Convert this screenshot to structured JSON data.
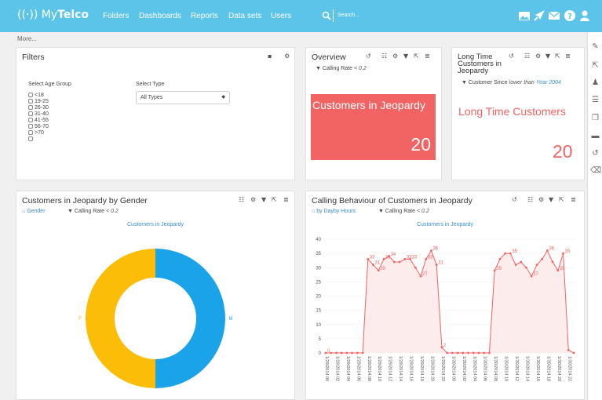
{
  "app": {
    "logo_icon": "((·))",
    "name_a": "My",
    "name_b": "Telco"
  },
  "nav": [
    "Folders",
    "Dashboards",
    "Reports",
    "Data sets",
    "Users"
  ],
  "search": {
    "placeholder": "Search..."
  },
  "toolbar_more": "More...",
  "filters": {
    "title": "Filters",
    "age_label": "Select Age Group",
    "age_options": [
      "<18",
      "19-25",
      "26-30",
      "31-40",
      "41-55",
      "56-70",
      ">70",
      ""
    ],
    "type_label": "Select Type",
    "type_value": "All Types"
  },
  "overview": {
    "title": "Overview",
    "filter_label": "Calling Rate",
    "filter_value": "< 0.2",
    "kpi_label": "Customers in Jeopardy",
    "kpi_value": "20"
  },
  "longtime": {
    "title": "Long Time Customers in Jeopardy",
    "filter_label": "Customer Since",
    "filter_mid": "lower than",
    "filter_value": "Year 2004",
    "kpi_label": "Long Time Customers",
    "kpi_value": "20"
  },
  "gender": {
    "title": "Customers in Jeopardy by Gender",
    "hier_label": "Gender",
    "filter_label": "Calling Rate",
    "filter_value": "< 0.2"
  },
  "calling": {
    "title": "Calling Behaviour of Customers in Jeopardy",
    "hier_label": "by Dayby Hours",
    "filter_label": "Calling Rate",
    "filter_value": "< 0.2"
  },
  "chart_data": [
    {
      "type": "pie",
      "title": "Customers in Jeopardy",
      "categories": [
        "M",
        "F"
      ],
      "values": [
        50,
        50
      ],
      "colors": [
        "#1aa3e8",
        "#fbbd08"
      ],
      "donut": true
    },
    {
      "type": "area",
      "title": "Customers in Jeopardy",
      "ylim": [
        0,
        40
      ],
      "yticks": [
        0,
        5,
        10,
        15,
        20,
        25,
        30,
        35,
        40
      ],
      "grid": true,
      "color": "#f26464",
      "x": [
        "1/29/2014 00",
        "1/29/2014 01",
        "1/29/2014 02",
        "1/29/2014 03",
        "1/29/2014 04",
        "1/29/2014 05",
        "1/29/2014 06",
        "1/29/2014 07",
        "1/29/2014 08",
        "1/29/2014 09",
        "1/29/2014 10",
        "1/29/2014 11",
        "1/29/2014 12",
        "1/29/2014 13",
        "1/29/2014 14",
        "1/29/2014 15",
        "1/29/2014 16",
        "1/29/2014 17",
        "1/29/2014 18",
        "1/29/2014 19",
        "1/29/2014 20",
        "1/29/2014 21",
        "1/29/2014 22",
        "1/29/2014 23",
        "1/30/2014 00",
        "1/30/2014 01",
        "1/30/2014 02",
        "1/30/2014 03",
        "1/30/2014 04",
        "1/30/2014 05",
        "1/30/2014 06",
        "1/30/2014 07",
        "1/30/2014 08",
        "1/30/2014 09",
        "1/30/2014 10",
        "1/30/2014 11",
        "1/30/2014 12",
        "1/30/2014 13",
        "1/30/2014 14",
        "1/30/2014 15",
        "1/30/2014 16",
        "1/30/2014 17",
        "1/30/2014 18",
        "1/30/2014 19",
        "1/30/2014 20",
        "1/30/2014 21",
        "1/30/2014 22",
        "1/30/2014 23"
      ],
      "tick_labels": [
        "1/29/2014 00",
        "1/29/2014 02",
        "1/29/2014 04",
        "1/29/2014 06",
        "1/29/2014 08",
        "1/29/2014 10",
        "1/29/2014 12",
        "1/29/2014 14",
        "1/29/2014 16",
        "1/29/2014 18",
        "1/29/2014 20",
        "1/29/2014 22",
        "1/30/2014 00",
        "1/30/2014 02",
        "1/30/2014 04",
        "1/30/2014 06",
        "1/30/2014 08",
        "1/30/2014 10",
        "1/30/2014 12",
        "1/30/2014 14",
        "1/30/2014 16",
        "1/30/2014 18",
        "1/30/2014 20",
        "1/30/2014 22"
      ],
      "values": [
        0,
        0,
        0,
        0,
        0,
        0,
        0,
        0,
        33,
        31,
        29,
        33,
        34,
        32,
        32,
        33,
        33,
        30,
        27,
        33,
        36,
        31,
        2,
        0,
        0,
        0,
        0,
        0,
        0,
        0,
        0,
        0,
        29,
        33,
        35,
        35,
        31,
        32,
        30,
        27,
        31,
        33,
        36,
        32,
        29,
        35,
        1,
        0
      ],
      "labels": [
        "0",
        "",
        "",
        "",
        "",
        "",
        "",
        "",
        "33",
        "31",
        "29",
        "33",
        "34",
        "",
        "",
        "33",
        "33",
        "",
        "27",
        "33",
        "36",
        "31",
        "2",
        "",
        "",
        "",
        "",
        "",
        "",
        "",
        "",
        "",
        "29",
        "",
        "",
        "35",
        "",
        "",
        "",
        "27",
        "",
        "",
        "36",
        "",
        "29",
        "35",
        "",
        ""
      ]
    }
  ]
}
